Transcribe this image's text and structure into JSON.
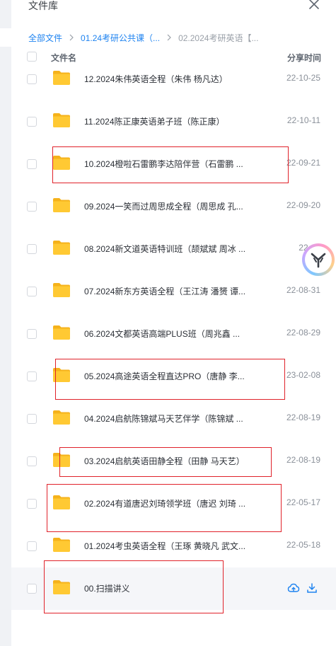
{
  "panel": {
    "title": "文件库"
  },
  "breadcrumb": {
    "items": [
      "全部文件",
      "01.24考研公共课（...",
      "02.2024考研英语【..."
    ]
  },
  "columns": {
    "name": "文件名",
    "share_time": "分享时间"
  },
  "files": [
    {
      "name": "12.2024朱伟英语全程（朱伟 杨凡达）",
      "date": "22-10-25"
    },
    {
      "name": "11.2024陈正康英语弟子班（陈正康）",
      "date": "22-10-11"
    },
    {
      "name": "10.2024橙啦石雷鹏李达陪伴营（石雷鹏 ...",
      "date": "22-09-21"
    },
    {
      "name": "09.2024一笑而过周思成全程（周思成 孔...",
      "date": "22-09-20"
    },
    {
      "name": "08.2024新文道英语特训班（颉斌斌 周冰 ...",
      "date": "22-09"
    },
    {
      "name": "07.2024新东方英语全程（王江涛 潘赟 谭...",
      "date": "22-08-31"
    },
    {
      "name": "06.2024文都英语高端PLUS班（周兆鑫 ...",
      "date": "22-08-29"
    },
    {
      "name": "05.2024高途英语全程直达PRO（唐静 李...",
      "date": "23-02-08"
    },
    {
      "name": "04.2024启航陈锦斌马天艺伴学（陈锦斌 ...",
      "date": "22-08-19"
    },
    {
      "name": "03.2024启航英语田静全程（田静 马天艺）",
      "date": "22-08-19"
    },
    {
      "name": "02.2024有道唐迟刘琦领学班（唐迟 刘琦 ...",
      "date": "22-05-17"
    },
    {
      "name": "01.2024考虫英语全程（王琢 黄晓凡 武文...",
      "date": "22-05-18"
    },
    {
      "name": "00.扫描讲义",
      "date": ""
    }
  ],
  "colors": {
    "accent": "#1e83f0",
    "folder": "#ffc933",
    "highlight": "#e0222a"
  },
  "icons": {
    "close": "close-icon",
    "folder": "folder-icon",
    "save_to_cloud": "cloud-upload-icon",
    "download": "download-icon",
    "assistant": "assistant-logo-icon"
  }
}
